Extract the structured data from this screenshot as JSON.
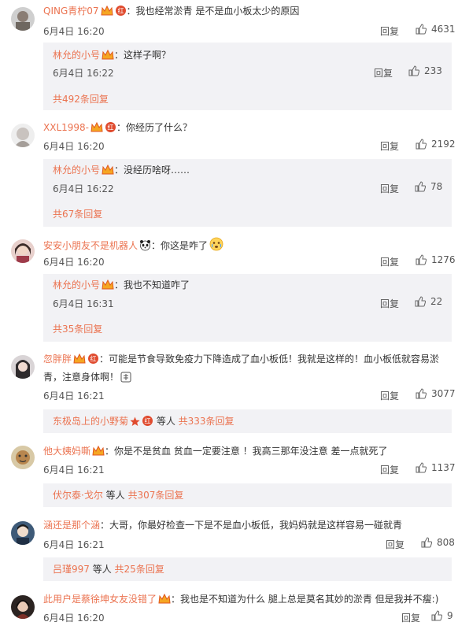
{
  "comments": [
    {
      "user": "QING青柠07",
      "text": "：我也经常淤青 是不是血小板太少的原因",
      "date": "6月4日 16:20",
      "reply_label": "回复",
      "likes": "4631",
      "sub": {
        "user": "林允的小号",
        "text": "：这样子啊？",
        "date": "6月4日 16:22",
        "reply_label": "回复",
        "likes": "233",
        "more": "共492条回复"
      }
    },
    {
      "user": "XXL1998-",
      "text": "：你经历了什么？",
      "date": "6月4日 16:20",
      "reply_label": "回复",
      "likes": "2192",
      "sub": {
        "user": "林允的小号",
        "text": "：没经历啥呀……",
        "date": "6月4日 16:22",
        "reply_label": "回复",
        "likes": "78",
        "more": "共67条回复"
      }
    },
    {
      "user": "安安小朋友不是机器人",
      "text": "：你这是咋了",
      "date": "6月4日 16:20",
      "reply_label": "回复",
      "likes": "1276",
      "sub": {
        "user": "林允的小号",
        "text": "：我也不知道咋了",
        "date": "6月4日 16:31",
        "reply_label": "回复",
        "likes": "22",
        "more": "共35条回复"
      }
    },
    {
      "user": "忽胖胖",
      "text_a": "：可能是节食导致免疫力下降造成了血小板低！我就是这样的！血小板低就容易淤",
      "text_b": "青，注意身体啊！",
      "date": "6月4日 16:21",
      "reply_label": "回复",
      "likes": "3077",
      "sub": {
        "user": "东极岛上的小野菊",
        "mid": " 等人 ",
        "more": "共333条回复"
      }
    },
    {
      "user": "他大姨妈嘶",
      "text": "：你是不是贫血 贫血一定要注意 ！我高三那年没注意 差一点就死了",
      "date": "6月4日 16:21",
      "reply_label": "回复",
      "likes": "1137",
      "sub": {
        "user": "伏尔泰·戈尔",
        "mid": " 等人 ",
        "more": "共307条回复"
      }
    },
    {
      "user": "涵还是那个涵",
      "text": "：大哥，你最好检查一下是不是血小板低，我妈妈就是这样容易一碰就青",
      "date": "6月4日 16:21",
      "reply_label": "回复",
      "likes": "808",
      "sub": {
        "user": "吕瑾997",
        "mid": " 等人 ",
        "more": "共25条回复"
      }
    },
    {
      "user": "此用户是蔡徐坤女友没错了",
      "text": "：我也是不知道为什么 腿上总是莫名其妙的淤青 但是我并不瘦:)",
      "date": "6月4日 16:20",
      "reply_label": "回复",
      "likes": "9"
    }
  ],
  "colors": {
    "username": "#eb7350",
    "sub_bg": "#f2f2f5",
    "text": "#333333",
    "meta": "#555555"
  },
  "icons": [
    "vip-crown-icon",
    "red-badge-icon",
    "thumb-up-icon",
    "panda-emoji-icon",
    "crying-emoji-icon",
    "star-icon"
  ]
}
